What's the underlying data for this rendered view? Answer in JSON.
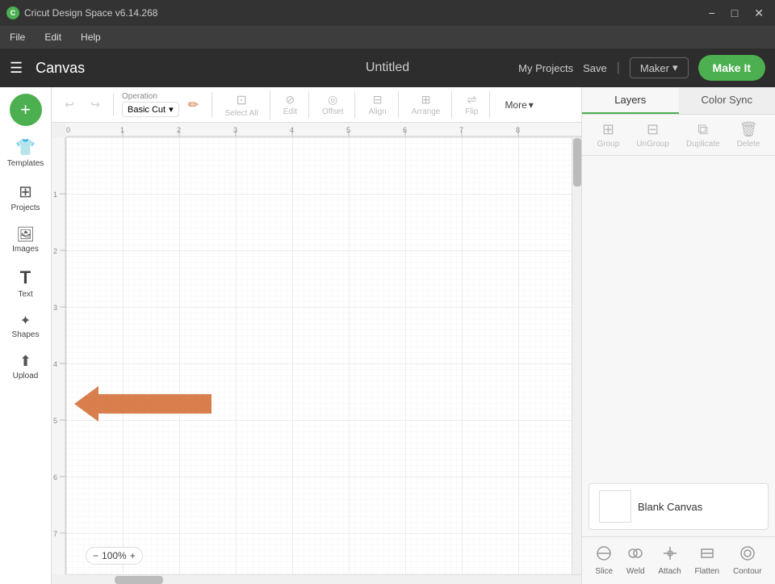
{
  "titlebar": {
    "app_name": "Cricut Design Space v6.14.268",
    "logo_letter": "C",
    "win_minimize": "−",
    "win_maximize": "□",
    "win_close": "✕"
  },
  "menubar": {
    "items": [
      "File",
      "Edit",
      "Help"
    ]
  },
  "appbar": {
    "hamburger": "☰",
    "canvas_label": "Canvas",
    "doc_title": "Untitled",
    "my_projects": "My Projects",
    "save": "Save",
    "divider": "|",
    "machine_label": "Maker",
    "machine_chevron": "▾",
    "make_it": "Make It"
  },
  "toolbar": {
    "undo_icon": "↩",
    "redo_icon": "↪",
    "operation_label": "Operation",
    "operation_value": "Basic Cut",
    "operation_chevron": "▾",
    "pencil_icon": "✏",
    "select_all_label": "Select All",
    "edit_label": "Edit",
    "offset_label": "Offset",
    "align_label": "Align",
    "arrange_label": "Arrange",
    "flip_label": "Flip",
    "more_label": "More",
    "more_chevron": "▾"
  },
  "sidebar": {
    "new_icon": "+",
    "new_label": "New",
    "items": [
      {
        "id": "templates",
        "icon": "👕",
        "label": "Templates"
      },
      {
        "id": "projects",
        "icon": "⊞",
        "label": "Projects"
      },
      {
        "id": "images",
        "icon": "🖼",
        "label": "Images"
      },
      {
        "id": "text",
        "icon": "T",
        "label": "Text"
      },
      {
        "id": "shapes",
        "icon": "✦",
        "label": "Shapes"
      },
      {
        "id": "upload",
        "icon": "⬆",
        "label": "Upload"
      }
    ]
  },
  "ruler": {
    "top_marks": [
      "0",
      "1",
      "2",
      "3",
      "4",
      "5",
      "6",
      "7",
      "8"
    ],
    "left_marks": [
      "1",
      "2",
      "3",
      "4",
      "5",
      "6",
      "7"
    ]
  },
  "right_panel": {
    "tabs": [
      {
        "id": "layers",
        "label": "Layers"
      },
      {
        "id": "color_sync",
        "label": "Color Sync"
      }
    ],
    "active_tab": "layers",
    "toolbar": {
      "group_label": "Group",
      "ungroup_label": "UnGroup",
      "duplicate_label": "Duplicate",
      "delete_label": "Delete"
    },
    "blank_canvas_label": "Blank Canvas"
  },
  "bottom_actions": {
    "items": [
      {
        "id": "slice",
        "icon": "⊗",
        "label": "Slice"
      },
      {
        "id": "weld",
        "icon": "⊕",
        "label": "Weld"
      },
      {
        "id": "attach",
        "icon": "📎",
        "label": "Attach"
      },
      {
        "id": "flatten",
        "icon": "⊟",
        "label": "Flatten"
      },
      {
        "id": "contour",
        "icon": "◎",
        "label": "Contour"
      }
    ]
  },
  "zoom": {
    "value": "100%",
    "minus": "−",
    "plus": "+"
  },
  "colors": {
    "green": "#4caf50",
    "dark_bg": "#2d2d2d",
    "mid_bg": "#3d3d3d",
    "border": "#dddddd",
    "arrow": "#d4713a"
  }
}
